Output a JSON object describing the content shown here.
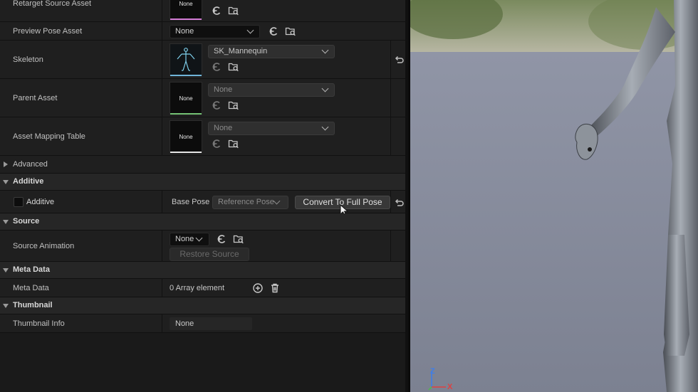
{
  "details": {
    "retarget_source_asset": {
      "label": "Retarget Source Asset",
      "thumb_text": "None"
    },
    "preview_pose_asset": {
      "label": "Preview Pose Asset",
      "value": "None"
    },
    "skeleton": {
      "label": "Skeleton",
      "value": "SK_Mannequin"
    },
    "parent_asset": {
      "label": "Parent Asset",
      "thumb_text": "None",
      "value": "None"
    },
    "asset_mapping_table": {
      "label": "Asset Mapping Table",
      "thumb_text": "None",
      "value": "None"
    },
    "advanced": {
      "label": "Advanced"
    }
  },
  "additive": {
    "category": "Additive",
    "checkbox_label": "Additive",
    "checkbox_checked": false,
    "base_pose_label": "Base Pose",
    "base_pose_value": "Reference Pose",
    "convert_button": "Convert To Full Pose"
  },
  "source": {
    "category": "Source",
    "source_animation_label": "Source Animation",
    "source_animation_value": "None",
    "restore_button": "Restore Source"
  },
  "meta_data": {
    "category": "Meta Data",
    "label": "Meta Data",
    "value": "0 Array element"
  },
  "thumbnail": {
    "category": "Thumbnail",
    "label": "Thumbnail Info",
    "value": "None"
  },
  "viewport": {
    "axis_z": "Z",
    "axis_x": "X"
  },
  "colors": {
    "retarget_underline": "#d37cd6",
    "skeleton_underline": "#6fb4d8",
    "parent_underline": "#74c274",
    "mapping_underline": "#e6e6e6",
    "axis_z": "#3f7ee8",
    "axis_x": "#e04040"
  }
}
